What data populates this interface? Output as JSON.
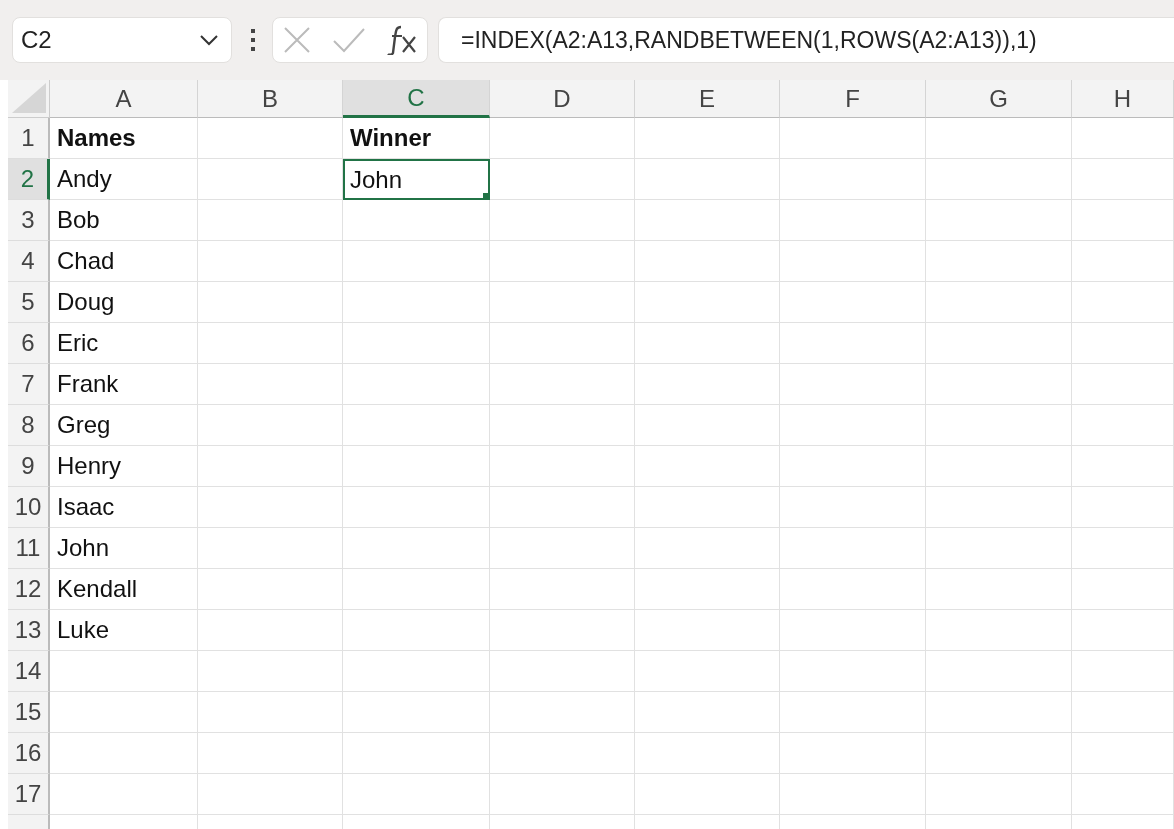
{
  "name_box": {
    "value": "C2"
  },
  "formula_bar": {
    "value": "=INDEX(A2:A13,RANDBETWEEN(1,ROWS(A2:A13)),1)"
  },
  "columns": [
    {
      "label": "A",
      "selected": false
    },
    {
      "label": "B",
      "selected": false
    },
    {
      "label": "C",
      "selected": true
    },
    {
      "label": "D",
      "selected": false
    },
    {
      "label": "E",
      "selected": false
    },
    {
      "label": "F",
      "selected": false
    },
    {
      "label": "G",
      "selected": false
    },
    {
      "label": "H",
      "selected": false
    }
  ],
  "rows": [
    {
      "label": "1",
      "selected": false,
      "cells": {
        "A": {
          "text": "Names",
          "bold": true,
          "selected": false
        },
        "C": {
          "text": "Winner",
          "bold": true,
          "selected": false
        }
      }
    },
    {
      "label": "2",
      "selected": true,
      "cells": {
        "A": {
          "text": "Andy",
          "bold": false,
          "selected": false
        },
        "C": {
          "text": "John",
          "bold": false,
          "selected": true
        }
      }
    },
    {
      "label": "3",
      "selected": false,
      "cells": {
        "A": {
          "text": "Bob",
          "bold": false,
          "selected": false
        }
      }
    },
    {
      "label": "4",
      "selected": false,
      "cells": {
        "A": {
          "text": "Chad",
          "bold": false,
          "selected": false
        }
      }
    },
    {
      "label": "5",
      "selected": false,
      "cells": {
        "A": {
          "text": "Doug",
          "bold": false,
          "selected": false
        }
      }
    },
    {
      "label": "6",
      "selected": false,
      "cells": {
        "A": {
          "text": "Eric",
          "bold": false,
          "selected": false
        }
      }
    },
    {
      "label": "7",
      "selected": false,
      "cells": {
        "A": {
          "text": "Frank",
          "bold": false,
          "selected": false
        }
      }
    },
    {
      "label": "8",
      "selected": false,
      "cells": {
        "A": {
          "text": "Greg",
          "bold": false,
          "selected": false
        }
      }
    },
    {
      "label": "9",
      "selected": false,
      "cells": {
        "A": {
          "text": "Henry",
          "bold": false,
          "selected": false
        }
      }
    },
    {
      "label": "10",
      "selected": false,
      "cells": {
        "A": {
          "text": "Isaac",
          "bold": false,
          "selected": false
        }
      }
    },
    {
      "label": "11",
      "selected": false,
      "cells": {
        "A": {
          "text": "John",
          "bold": false,
          "selected": false
        }
      }
    },
    {
      "label": "12",
      "selected": false,
      "cells": {
        "A": {
          "text": "Kendall",
          "bold": false,
          "selected": false
        }
      }
    },
    {
      "label": "13",
      "selected": false,
      "cells": {
        "A": {
          "text": "Luke",
          "bold": false,
          "selected": false
        }
      }
    },
    {
      "label": "14",
      "selected": false
    },
    {
      "label": "15",
      "selected": false
    },
    {
      "label": "16",
      "selected": false
    },
    {
      "label": "17",
      "selected": false
    }
  ]
}
